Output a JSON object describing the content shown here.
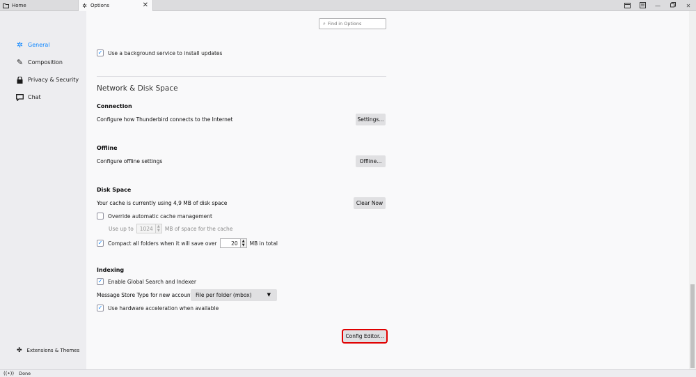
{
  "tabs": {
    "home_label": "Home",
    "options_label": "Options",
    "close_glyph": "✕"
  },
  "sidebar": {
    "categories": [
      {
        "label": "General",
        "icon": "gear-icon",
        "selected": true
      },
      {
        "label": "Composition",
        "icon": "pencil-icon"
      },
      {
        "label": "Privacy & Security",
        "icon": "lock-icon"
      },
      {
        "label": "Chat",
        "icon": "chat-bubble-icon"
      }
    ],
    "extensions_label": "Extensions & Themes"
  },
  "search": {
    "placeholder": "Find in Options"
  },
  "updates": {
    "background_service_label": "Use a background service to install updates",
    "checked": true
  },
  "network": {
    "title": "Network & Disk Space",
    "connection": {
      "heading": "Connection",
      "description": "Configure how Thunderbird connects to the Internet",
      "button": "Settings..."
    },
    "offline": {
      "heading": "Offline",
      "description": "Configure offline settings",
      "button": "Offline..."
    },
    "disk": {
      "heading": "Disk Space",
      "cache_text": "Your cache is currently using 4,9 MB of disk space",
      "clear_button": "Clear Now",
      "override_label": "Override automatic cache management",
      "override_checked": false,
      "use_up_to_label": "Use up to",
      "use_up_to_value": "1024",
      "use_up_to_suffix": "MB of space for the cache",
      "compact_label": "Compact all folders when it will save over",
      "compact_checked": true,
      "compact_value": "20",
      "compact_suffix": "MB in total"
    }
  },
  "indexing": {
    "heading": "Indexing",
    "global_search_label": "Enable Global Search and Indexer",
    "global_search_checked": true,
    "store_type_label": "Message Store Type for new accounts:",
    "store_type_value": "File per folder (mbox)",
    "hw_accel_label": "Use hardware acceleration when available",
    "hw_accel_checked": true
  },
  "config_editor_button": "Config Editor...",
  "status": {
    "text": "Done"
  },
  "colors": {
    "accent": "#0a84ff",
    "highlight": "#e00000"
  }
}
